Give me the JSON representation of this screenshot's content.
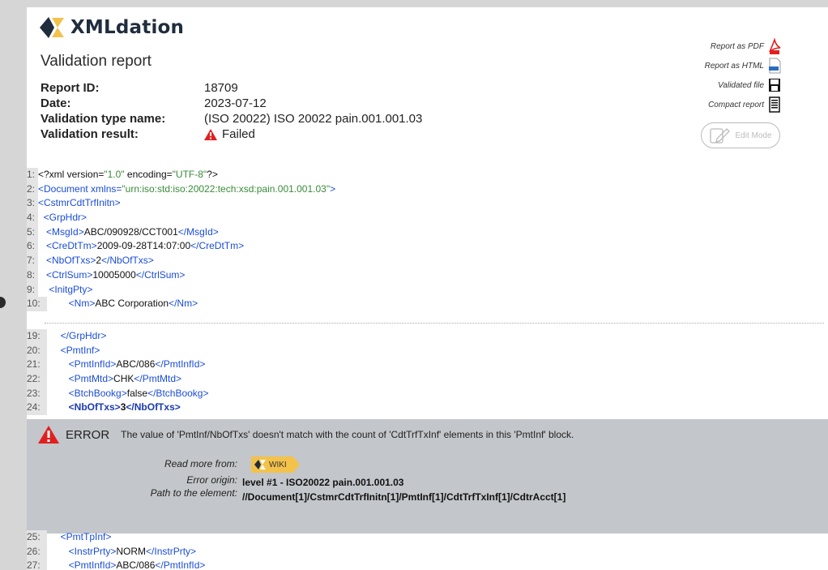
{
  "brand": {
    "name": "XMLdation"
  },
  "report": {
    "title": "Validation report",
    "fields": [
      {
        "label": "Report ID:",
        "value": "18709"
      },
      {
        "label": "Date:",
        "value": "2023-07-12"
      },
      {
        "label": "Validation type name:",
        "value": "(ISO 20022) ISO 20022 pain.001.001.03"
      },
      {
        "label": "Validation result:",
        "value": "Failed"
      }
    ]
  },
  "actions": {
    "pdf": "Report as PDF",
    "html": "Report as HTML",
    "validated": "Validated file",
    "compact": "Compact report",
    "edit_mode": "Edit Mode"
  },
  "code_top": [
    {
      "n": "1:",
      "parts": [
        [
          "pi",
          "<?xml version="
        ],
        [
          "aval",
          "\"1.0\""
        ],
        [
          "pi",
          " encoding="
        ],
        [
          "aval",
          "\"UTF-8\""
        ],
        [
          "pi",
          "?>"
        ]
      ]
    },
    {
      "n": "2:",
      "parts": [
        [
          "tag",
          "<Document "
        ],
        [
          "attr",
          "xmlns="
        ],
        [
          "aval",
          "\"urn:iso:std:iso:20022:tech:xsd:pain.001.001.03\""
        ],
        [
          "tag",
          ">"
        ]
      ]
    },
    {
      "n": "3:",
      "parts": [
        [
          "tag",
          "<CstmrCdtTrfInitn>"
        ]
      ]
    },
    {
      "n": "4:",
      "parts": [
        [
          "tag",
          "  <GrpHdr>"
        ]
      ]
    },
    {
      "n": "5:",
      "parts": [
        [
          "tag",
          "   <MsgId>"
        ],
        [
          "txt",
          "ABC/090928/CCT001"
        ],
        [
          "tag",
          "</MsgId>"
        ]
      ]
    },
    {
      "n": "6:",
      "parts": [
        [
          "tag",
          "   <CreDtTm>"
        ],
        [
          "txt",
          "2009-09-28T14:07:00"
        ],
        [
          "tag",
          "</CreDtTm>"
        ]
      ]
    },
    {
      "n": "7:",
      "parts": [
        [
          "tag",
          "   <NbOfTxs>"
        ],
        [
          "txt",
          "2"
        ],
        [
          "tag",
          "</NbOfTxs>"
        ]
      ]
    },
    {
      "n": "8:",
      "parts": [
        [
          "tag",
          "   <CtrlSum>"
        ],
        [
          "txt",
          "10005000"
        ],
        [
          "tag",
          "</CtrlSum>"
        ]
      ]
    },
    {
      "n": "9:",
      "parts": [
        [
          "tag",
          "    <InitgPty>"
        ]
      ]
    },
    {
      "n": "10:",
      "parts": [
        [
          "tag",
          "        <Nm>"
        ],
        [
          "txt",
          "ABC Corporation"
        ],
        [
          "tag",
          "</Nm>"
        ]
      ]
    }
  ],
  "code_mid": [
    {
      "n": "19:",
      "parts": [
        [
          "tag",
          "     </GrpHdr>"
        ]
      ]
    },
    {
      "n": "20:",
      "parts": [
        [
          "tag",
          "     <PmtInf>"
        ]
      ]
    },
    {
      "n": "21:",
      "parts": [
        [
          "tag",
          "        <PmtInfId>"
        ],
        [
          "txt",
          "ABC/086"
        ],
        [
          "tag",
          "</PmtInfId>"
        ]
      ]
    },
    {
      "n": "22:",
      "parts": [
        [
          "tag",
          "        <PmtMtd>"
        ],
        [
          "txt",
          "CHK"
        ],
        [
          "tag",
          "</PmtMtd>"
        ]
      ]
    },
    {
      "n": "23:",
      "parts": [
        [
          "tag",
          "        <BtchBookg>"
        ],
        [
          "txt",
          "false"
        ],
        [
          "tag",
          "</BtchBookg>"
        ]
      ]
    },
    {
      "n": "24:",
      "bold": true,
      "parts": [
        [
          "tag",
          "        <NbOfTxs>"
        ],
        [
          "txt",
          "3"
        ],
        [
          "tag",
          "</NbOfTxs>"
        ]
      ]
    }
  ],
  "error": {
    "label": "ERROR",
    "message": "The value of 'PmtInf/NbOfTxs' doesn't match with the count of 'CdtTrfTxInf' elements in this 'PmtInf' block.",
    "read_more_label": "Read more from:",
    "wiki_label": "WIKI",
    "origin_label": "Error origin:",
    "origin_value": "level #1 - ISO20022 pain.001.001.03",
    "path_label": "Path to the element:",
    "path_value": "//Document[1]/CstmrCdtTrfInitn[1]/PmtInf[1]/CdtTrfTxInf[1]/CdtrAcct[1]"
  },
  "code_bottom": [
    {
      "n": "25:",
      "parts": [
        [
          "tag",
          "     <PmtTpInf>"
        ]
      ]
    },
    {
      "n": "26:",
      "parts": [
        [
          "tag",
          "        <InstrPrty>"
        ],
        [
          "txt",
          "NORM"
        ],
        [
          "tag",
          "</InstrPrty>"
        ]
      ]
    },
    {
      "n": "27:",
      "parts": [
        [
          "tag",
          "        <PmtInfId>"
        ],
        [
          "txt",
          "ABC/086"
        ],
        [
          "tag",
          "</PmtInfId>"
        ]
      ]
    }
  ],
  "colors": {
    "error_bg": "#c3c6ca",
    "tag": "#1a4dd8",
    "attr_value": "#3a8b3a",
    "warn": "#e02020",
    "logo_accent": "#f3c24b",
    "logo_dark": "#1f2d3d"
  },
  "icons": [
    "pdf-icon",
    "html-file-icon",
    "floppy-disk-icon",
    "compact-report-icon",
    "edit-pencil-icon",
    "warning-triangle-icon"
  ]
}
